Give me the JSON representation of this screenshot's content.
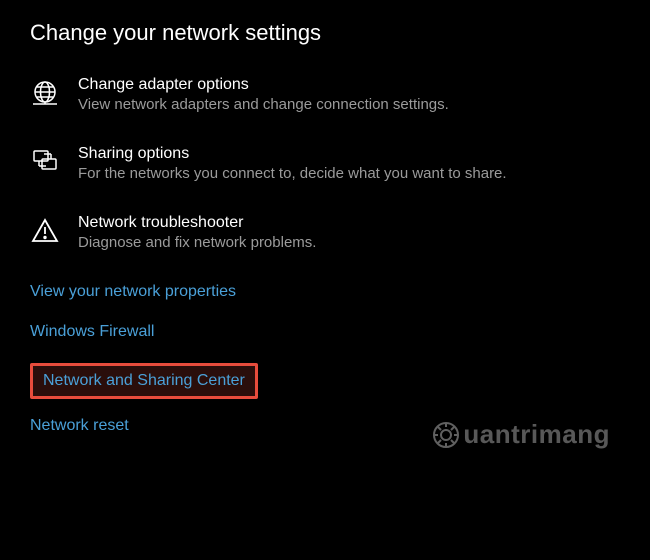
{
  "section_title": "Change your network settings",
  "items": [
    {
      "icon": "globe-icon",
      "title": "Change adapter options",
      "desc": "View network adapters and change connection settings."
    },
    {
      "icon": "sharing-icon",
      "title": "Sharing options",
      "desc": "For the networks you connect to, decide what you want to share."
    },
    {
      "icon": "warning-icon",
      "title": "Network troubleshooter",
      "desc": "Diagnose and fix network problems."
    }
  ],
  "links": {
    "view_properties": "View your network properties",
    "windows_firewall": "Windows Firewall",
    "network_sharing_center": "Network and Sharing Center",
    "network_reset": "Network reset"
  },
  "watermark": "uantrimang"
}
